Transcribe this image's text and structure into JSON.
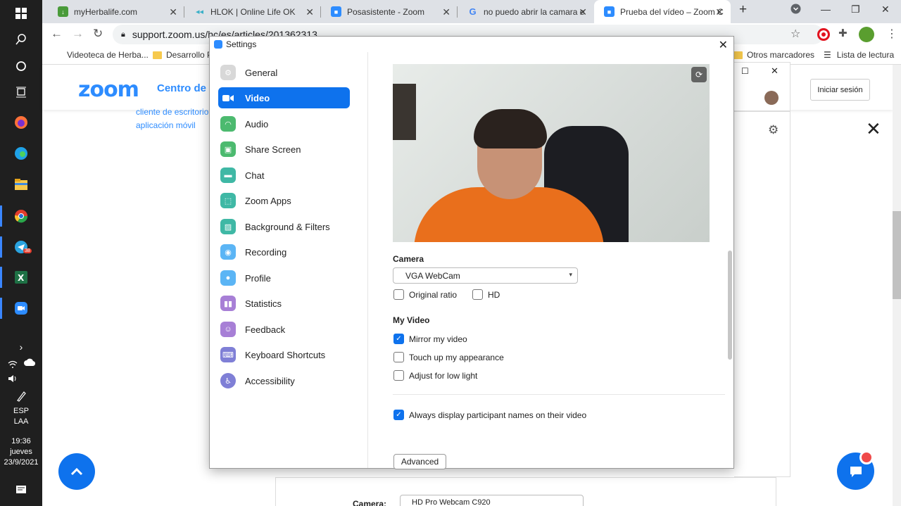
{
  "taskbar": {
    "lang": "ESP",
    "layout": "LAA",
    "time": "19:36",
    "day": "jueves",
    "date": "23/9/2021",
    "telegram_badge": "38"
  },
  "browser": {
    "tabs": [
      {
        "label": "myHerbalife.com"
      },
      {
        "label": "HLOK | Online Life OK"
      },
      {
        "label": "Posasistente - Zoom"
      },
      {
        "label": "no puedo abrir la camara e"
      },
      {
        "label": "Prueba del vídeo – Zoom C"
      }
    ],
    "url": "support.zoom.us/hc/es/articles/201362313",
    "bookmarks": [
      {
        "label": "Videoteca de Herba..."
      },
      {
        "label": "Desarrollo P"
      },
      {
        "label": "Otros marcadores"
      },
      {
        "label": "Lista de lectura"
      }
    ]
  },
  "page": {
    "logo": "zoom",
    "center_title": "Centro de a",
    "link1": "cliente de escritorio",
    "link2": "aplicación móvil",
    "signin": "Iniciar sesión",
    "bottom_camera_label": "Camera:",
    "bottom_camera_value": "HD Pro Webcam C920"
  },
  "settings": {
    "title": "Settings",
    "nav": [
      {
        "label": "General",
        "color": "#c9c9c9"
      },
      {
        "label": "Video",
        "color": "#0e72ed"
      },
      {
        "label": "Audio",
        "color": "#4cba6f"
      },
      {
        "label": "Share Screen",
        "color": "#4cba6f"
      },
      {
        "label": "Chat",
        "color": "#3fb8a5"
      },
      {
        "label": "Zoom Apps",
        "color": "#3fb8a5"
      },
      {
        "label": "Background & Filters",
        "color": "#3fb8a5"
      },
      {
        "label": "Recording",
        "color": "#5bb5f5"
      },
      {
        "label": "Profile",
        "color": "#5bb5f5"
      },
      {
        "label": "Statistics",
        "color": "#a77fd6"
      },
      {
        "label": "Feedback",
        "color": "#a77fd6"
      },
      {
        "label": "Keyboard Shortcuts",
        "color": "#7f7fd6"
      },
      {
        "label": "Accessibility",
        "color": "#7f7fd6"
      }
    ],
    "camera_label": "Camera",
    "camera_value": "VGA WebCam",
    "original_ratio": "Original ratio",
    "hd": "HD",
    "my_video": "My Video",
    "mirror": "Mirror my video",
    "touch_up": "Touch up my appearance",
    "low_light": "Adjust for low light",
    "always_display": "Always display participant names on their video",
    "advanced": "Advanced"
  }
}
